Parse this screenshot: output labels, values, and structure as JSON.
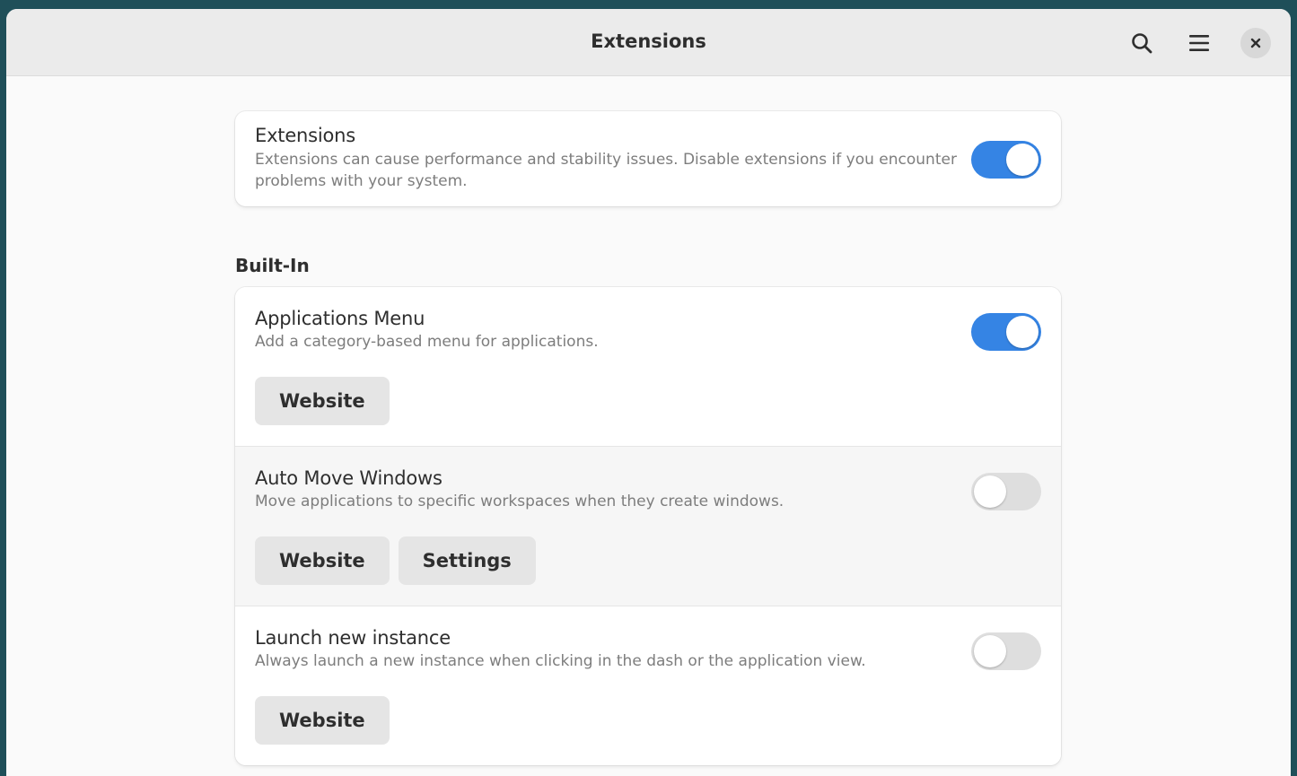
{
  "window": {
    "title": "Extensions"
  },
  "header": {
    "search_icon": "search-icon",
    "menu_icon": "hamburger-menu-icon",
    "close_icon": "close-icon"
  },
  "master": {
    "title": "Extensions",
    "subtitle": "Extensions can cause performance and stability issues. Disable extensions if you encounter problems with your system.",
    "enabled": true
  },
  "builtin": {
    "heading": "Built-In",
    "items": [
      {
        "name": "Applications Menu",
        "description": "Add a category-based menu for applications.",
        "enabled": true,
        "buttons": [
          "Website"
        ]
      },
      {
        "name": "Auto Move Windows",
        "description": "Move applications to specific workspaces when they create windows.",
        "enabled": false,
        "buttons": [
          "Website",
          "Settings"
        ]
      },
      {
        "name": "Launch new instance",
        "description": "Always launch a new instance when clicking in the dash or the application view.",
        "enabled": false,
        "buttons": [
          "Website"
        ]
      }
    ]
  },
  "colors": {
    "accent": "#3584e4",
    "switch_off": "#dedede",
    "headerbar": "#ebebeb",
    "window_bg": "#fafafa",
    "card_bg": "#ffffff",
    "button_bg": "#e5e5e5"
  }
}
